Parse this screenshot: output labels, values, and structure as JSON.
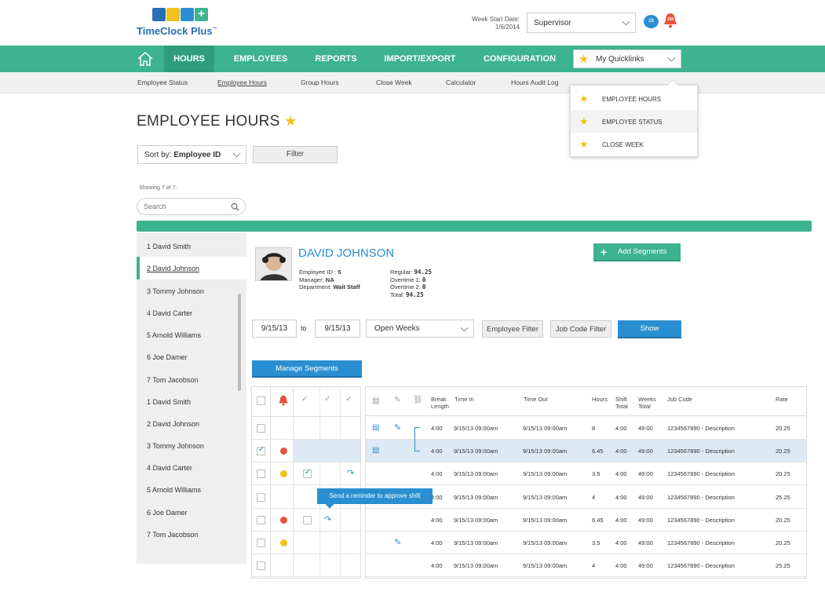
{
  "app": {
    "logo_text": "TimeClock Plus",
    "logo_tm": "™"
  },
  "colors": {
    "brand_green": "#3db38f",
    "link_blue": "#2a8fd0",
    "button_blue": "#2a8fd0",
    "star_gold": "#f1c21b",
    "alert_red": "#e5533d",
    "status_yellow": "#f1c21b",
    "selected_row": "#dde9f4"
  },
  "header": {
    "week_start_label": "Week Start Date:",
    "week_start_value": "1/6/2014",
    "role_select": "Supervisor",
    "chat_badge": "15",
    "alert_badge": "150"
  },
  "nav": {
    "home_icon": "home-icon",
    "items": [
      "HOURS",
      "EMPLOYEES",
      "REPORTS",
      "IMPORT/EXPORT",
      "CONFIGURATION"
    ],
    "quicklinks_label": "My Quicklinks"
  },
  "subnav": [
    "Employee Status",
    "Employee Hours",
    "Group Hours",
    "Close Week",
    "Calculator",
    "Hours Audit Log"
  ],
  "quicklinks": [
    "EMPLOYEE HOURS",
    "EMPLOYEE STATUS",
    "CLOSE WEEK"
  ],
  "page": {
    "title": "EMPLOYEE HOURS",
    "sort_prefix": "Sort by: ",
    "sort_value": "Employee ID",
    "filter_button": "Filter",
    "showing_text": "Showing 7 of 7:",
    "search_placeholder": "Search"
  },
  "employees": [
    "1  David Smith",
    "2  David Johnson",
    "3  Tommy Johnson",
    "4  David Carter",
    "5  Arnold Williams",
    "6  Joe Damer",
    "7  Tom Jacobson",
    "1  David Smith",
    "2  David Johnson",
    "3  Tommy Johnson",
    "4  David Carter",
    "5  Arnold Williams",
    "6  Joe Damer",
    "7  Tom Jacobson"
  ],
  "selected_employee": {
    "name": "DAVID JOHNSON",
    "id_label": "Employee ID : ",
    "id": "5",
    "manager_label": "Manager: ",
    "manager": "NA",
    "department_label": "Department: ",
    "department": "Wait Staff",
    "regular_label": "Regular: ",
    "regular": "94.25",
    "ot1_label": "Overtime 1: ",
    "ot1": "0",
    "ot2_label": "Overtime 2: ",
    "ot2": "0",
    "total_label": "Total: ",
    "total": "94.25",
    "add_segments": "Add Segments"
  },
  "range": {
    "from": "9/15/13",
    "to_label": "to",
    "to": "9/15/13",
    "period": "Open Weeks",
    "employee_filter": "Employee Filter",
    "job_code_filter": "Job Code Filter",
    "show": "Show",
    "manage_segments": "Manage Segments"
  },
  "table": {
    "headers": {
      "break": "Break Length",
      "time_in": "Time In",
      "time_out": "Time Out",
      "hours": "Hours",
      "shift_total": "Shift Total",
      "weeks_total": "Weeks Total",
      "job_code": "Job Code",
      "rate": "Rate"
    },
    "tooltip": "Send a reminder to approve shift",
    "rows": [
      {
        "checked": false,
        "status": "",
        "approved": false,
        "reminder": false,
        "note": true,
        "edit": true,
        "break": "4:00",
        "time_in": "9/15/13 09:00am",
        "time_out": "9/15/13 09:00am",
        "hours": "8",
        "shift_total": "4:00",
        "weeks_total": "49:00",
        "job_code": "1234567890  - Description",
        "rate": "20.25"
      },
      {
        "checked": true,
        "status": "red",
        "approved": false,
        "reminder": false,
        "note": true,
        "edit": false,
        "break": "4:00",
        "time_in": "9/15/13 09:00am",
        "time_out": "9/15/13 09:00am",
        "hours": "6.45",
        "shift_total": "4:00",
        "weeks_total": "49:00",
        "job_code": "1234567890  - Description",
        "rate": "20.25"
      },
      {
        "checked": false,
        "status": "yellow",
        "approved": true,
        "reminder": true,
        "note": false,
        "edit": false,
        "break": "4:00",
        "time_in": "9/15/13 09:00am",
        "time_out": "9/15/13 09:00am",
        "hours": "3.5",
        "shift_total": "4:00",
        "weeks_total": "49:00",
        "job_code": "1234567890  - Description",
        "rate": "20.25"
      },
      {
        "checked": false,
        "status": "",
        "approved": false,
        "reminder": false,
        "note": false,
        "edit": false,
        "break": "4:00",
        "time_in": "9/15/13 09:00am",
        "time_out": "9/15/13 09:00am",
        "hours": "4",
        "shift_total": "4:00",
        "weeks_total": "49:00",
        "job_code": "1234567890  - Description",
        "rate": "25.25"
      },
      {
        "checked": false,
        "status": "red",
        "approved": false,
        "reminder": true,
        "note": false,
        "edit": false,
        "break": "4:00",
        "time_in": "9/15/13 09:00am",
        "time_out": "9/15/13 09:00am",
        "hours": "6.45",
        "shift_total": "4:00",
        "weeks_total": "49:00",
        "job_code": "1234567890  - Description",
        "rate": "20.25"
      },
      {
        "checked": false,
        "status": "yellow",
        "approved": false,
        "reminder": false,
        "note": false,
        "edit": true,
        "break": "4:00",
        "time_in": "9/15/13 09:00am",
        "time_out": "9/15/13 09:00am",
        "hours": "3.5",
        "shift_total": "4:00",
        "weeks_total": "49:00",
        "job_code": "1234567890  - Description",
        "rate": "20.25"
      },
      {
        "checked": false,
        "status": "",
        "approved": false,
        "reminder": false,
        "note": false,
        "edit": false,
        "break": "4:00",
        "time_in": "9/15/13 09:00am",
        "time_out": "9/15/13 09:00am",
        "hours": "4",
        "shift_total": "4:00",
        "weeks_total": "49:00",
        "job_code": "1234567890  - Description",
        "rate": "25.25"
      }
    ]
  }
}
